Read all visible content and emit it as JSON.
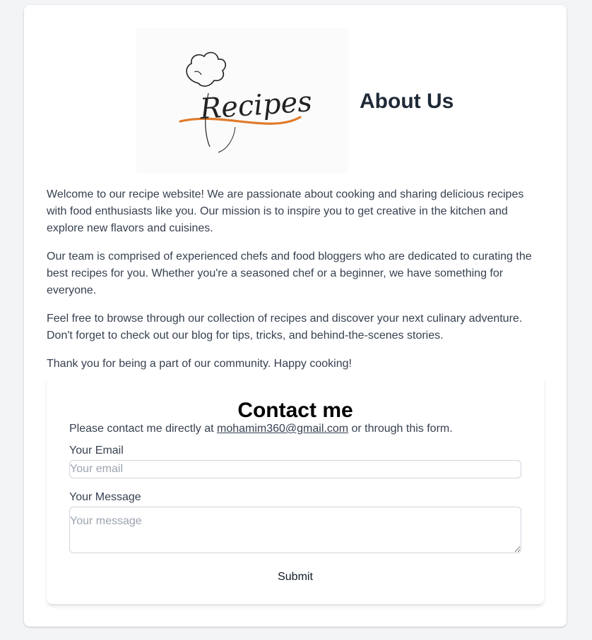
{
  "about": {
    "logo_text": "Recipes",
    "title": "About Us",
    "paragraphs": [
      "Welcome to our recipe website! We are passionate about cooking and sharing delicious recipes with food enthusiasts like you. Our mission is to inspire you to get creative in the kitchen and explore new flavors and cuisines.",
      "Our team is comprised of experienced chefs and food bloggers who are dedicated to curating the best recipes for you. Whether you're a seasoned chef or a beginner, we have something for everyone.",
      "Feel free to browse through our collection of recipes and discover your next culinary adventure. Don't forget to check out our blog for tips, tricks, and behind-the-scenes stories.",
      "Thank you for being a part of our community. Happy cooking!"
    ]
  },
  "contact": {
    "title": "Contact me",
    "intro_before": "Please contact me directly at ",
    "email_link": "mohamim360@gmail.com",
    "intro_after": " or through this form.",
    "email_label": "Your Email",
    "email_placeholder": "Your email",
    "message_label": "Your Message",
    "message_placeholder": "Your message",
    "submit_label": "Submit"
  },
  "colors": {
    "page_background": "#f3f4f6",
    "card_background": "#ffffff",
    "logo_accent": "#e07a2a",
    "heading": "#1f2937",
    "text": "#374151"
  }
}
